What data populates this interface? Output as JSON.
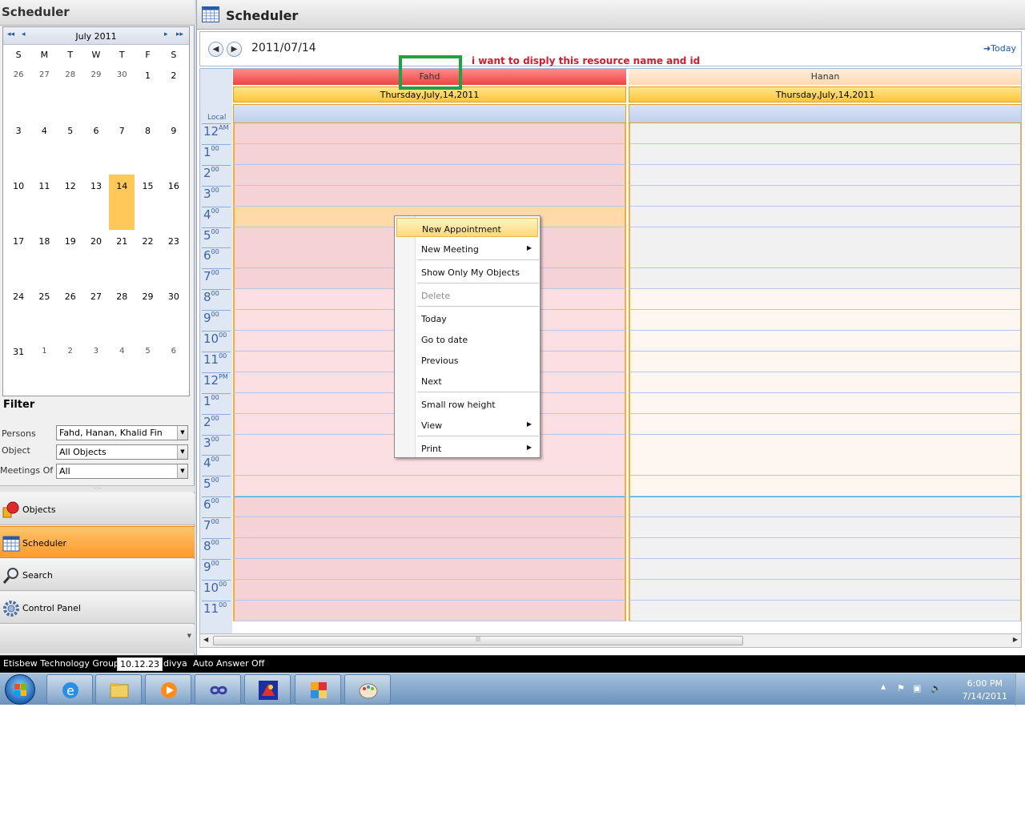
{
  "left": {
    "title": "Scheduler",
    "calendar": {
      "month_label": "July 2011",
      "nav_prev_year": "◂◂",
      "nav_prev": "◂",
      "nav_next": "▸",
      "nav_next_year": "▸▸",
      "dow": [
        "S",
        "M",
        "T",
        "W",
        "T",
        "F",
        "S"
      ],
      "weeks": [
        [
          "26",
          "27",
          "28",
          "29",
          "30",
          "1",
          "2"
        ],
        [
          "3",
          "4",
          "5",
          "6",
          "7",
          "8",
          "9"
        ],
        [
          "10",
          "11",
          "12",
          "13",
          "14",
          "15",
          "16"
        ],
        [
          "17",
          "18",
          "19",
          "20",
          "21",
          "22",
          "23"
        ],
        [
          "24",
          "25",
          "26",
          "27",
          "28",
          "29",
          "30"
        ],
        [
          "31",
          "1",
          "2",
          "3",
          "4",
          "5",
          "6"
        ]
      ],
      "selected_day": "14"
    },
    "filter": {
      "title": "Filter",
      "persons_label": "Persons",
      "persons_value": "Fahd, Hanan, Khalid Fin",
      "object_label": "Object",
      "object_value": "All Objects",
      "meetings_label": "Meetings Of",
      "meetings_value": "All"
    },
    "nav": {
      "objects": "Objects",
      "scheduler": "Scheduler",
      "search": "Search",
      "control_panel": "Control Panel"
    }
  },
  "right": {
    "title": "Scheduler",
    "date": "2011/07/14",
    "today_link": "Today",
    "annotation": "i want to disply this resource name and id",
    "local_label": "Local",
    "resources": [
      {
        "name": "Fahd",
        "date_header": "Thursday,July,14,2011"
      },
      {
        "name": "Hanan",
        "date_header": "Thursday,July,14,2011"
      }
    ],
    "hours": [
      {
        "h": "12",
        "s": "AM"
      },
      {
        "h": "1",
        "s": "00"
      },
      {
        "h": "2",
        "s": "00"
      },
      {
        "h": "3",
        "s": "00"
      },
      {
        "h": "4",
        "s": "00"
      },
      {
        "h": "5",
        "s": "00"
      },
      {
        "h": "6",
        "s": "00"
      },
      {
        "h": "7",
        "s": "00"
      },
      {
        "h": "8",
        "s": "00"
      },
      {
        "h": "9",
        "s": "00"
      },
      {
        "h": "10",
        "s": "00"
      },
      {
        "h": "11",
        "s": "00"
      },
      {
        "h": "12",
        "s": "PM"
      },
      {
        "h": "1",
        "s": "00"
      },
      {
        "h": "2",
        "s": "00"
      },
      {
        "h": "3",
        "s": "00"
      },
      {
        "h": "4",
        "s": "00"
      },
      {
        "h": "5",
        "s": "00"
      },
      {
        "h": "6",
        "s": "00"
      },
      {
        "h": "7",
        "s": "00"
      },
      {
        "h": "8",
        "s": "00"
      },
      {
        "h": "9",
        "s": "00"
      },
      {
        "h": "10",
        "s": "00"
      },
      {
        "h": "11",
        "s": "00"
      }
    ]
  },
  "context_menu": {
    "new_appointment": "New Appointment",
    "new_meeting": "New Meeting",
    "show_only_my_objects": "Show Only My Objects",
    "delete": "Delete",
    "today": "Today",
    "go_to_date": "Go to date",
    "previous": "Previous",
    "next": "Next",
    "small_row_height": "Small row height",
    "view": "View",
    "print": "Print"
  },
  "status": {
    "company": "Etisbew Technology Group",
    "ip": "10.12.23",
    "user": "divya",
    "auto_answer": "Auto Answer Off"
  },
  "taskbar": {
    "time": "6:00 PM",
    "date": "7/14/2011"
  },
  "colors": {
    "fahd_header": "#f25b5b",
    "hanan_header": "#ffe3c4",
    "fahd_slot": "#f4d2d6",
    "hanan_slot": "#f2f1f1",
    "selected_hour": "#ffd9a8",
    "accent_orange": "#ffa83a"
  }
}
